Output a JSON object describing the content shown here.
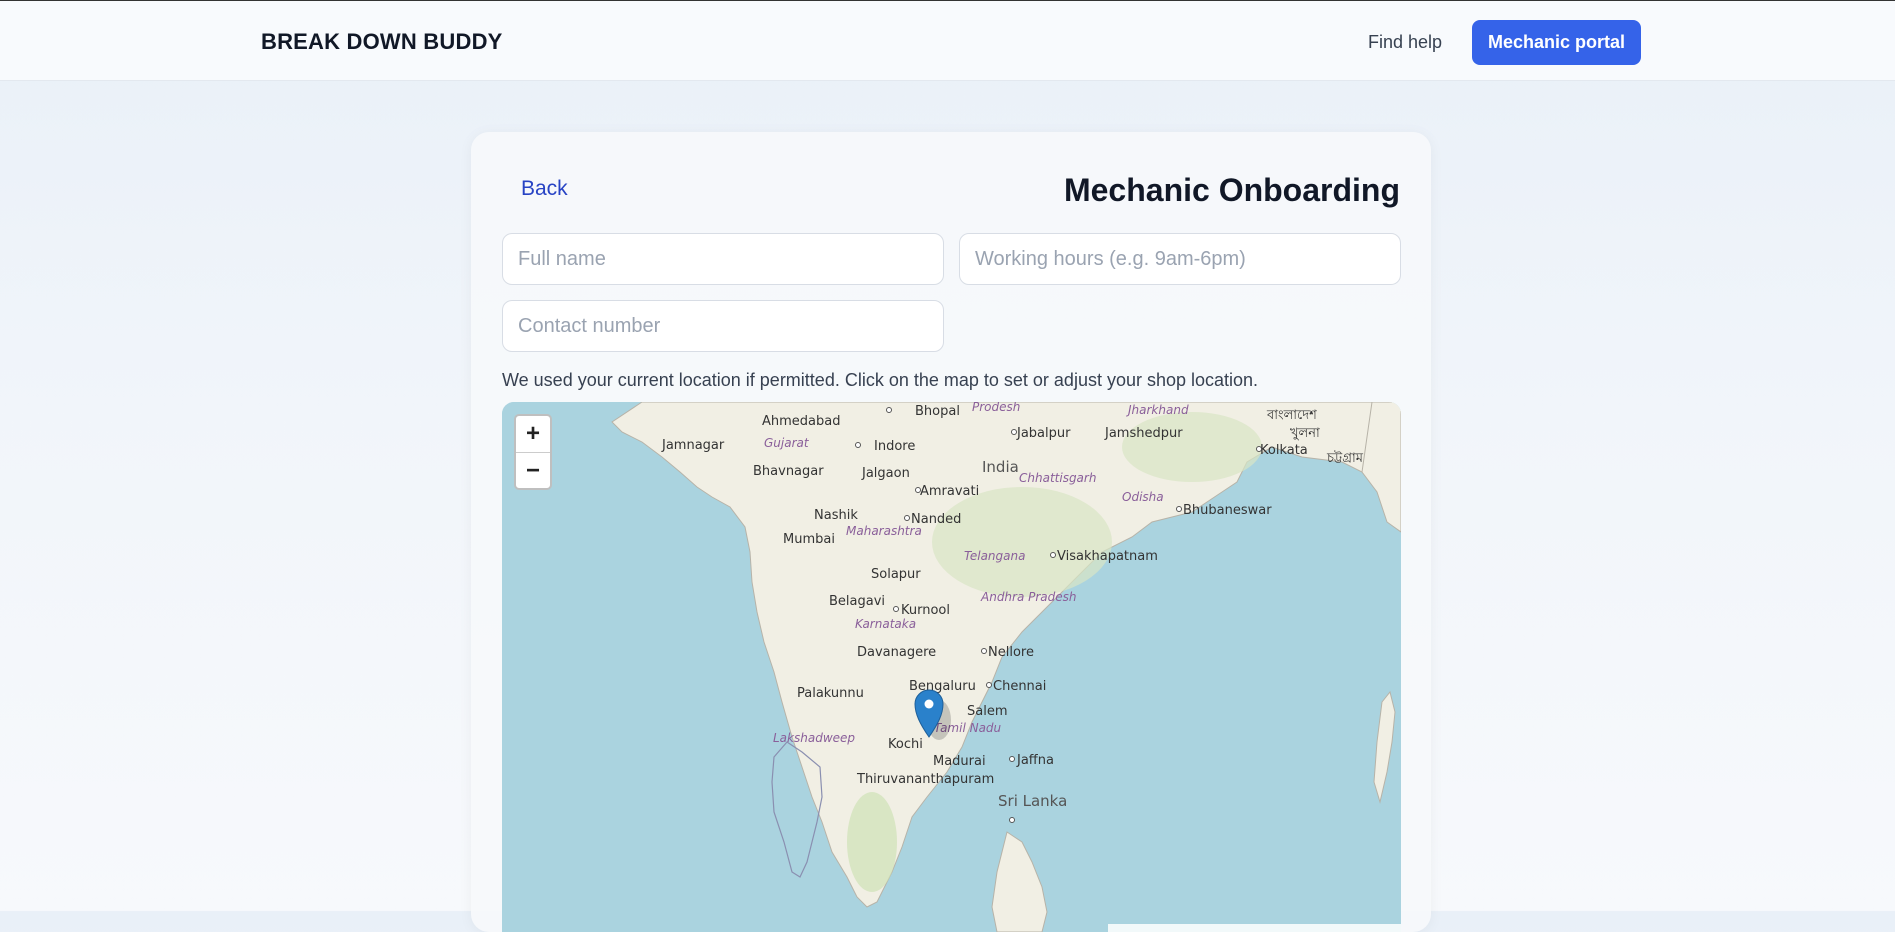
{
  "header": {
    "brand": "BREAK DOWN BUDDY",
    "find_help": "Find help",
    "mechanic_portal": "Mechanic portal"
  },
  "form": {
    "back": "Back",
    "title": "Mechanic Onboarding",
    "full_name_placeholder": "Full name",
    "working_hours_placeholder": "Working hours (e.g. 9am-6pm)",
    "contact_placeholder": "Contact number",
    "location_hint": "We used your current location if permitted. Click on the map to set or adjust your shop location."
  },
  "map": {
    "zoom_in": "+",
    "zoom_out": "−",
    "marker_icon": "map-pin-icon",
    "country": "India",
    "cities": [
      "Ahmedabad",
      "Bhopal",
      "Jabalpur",
      "Jamshedpur",
      "Kolkata",
      "Jamnagar",
      "Indore",
      "Bhavnagar",
      "Jalgaon",
      "Amravati",
      "Nashik",
      "Nanded",
      "Bhubaneswar",
      "Mumbai",
      "Visakhapatnam",
      "Solapur",
      "Belagavi",
      "Kurnool",
      "Davanagere",
      "Nellore",
      "Bengaluru",
      "Chennai",
      "Palakunnu",
      "Salem",
      "Kochi",
      "Madurai",
      "Jaffna",
      "Thiruvananthapuram",
      "Sri Lanka",
      "খুলনা",
      "চট্টগ্রাম",
      "বাংলাদেশ"
    ],
    "states": [
      "Prodesh",
      "Jharkhand",
      "Gujarat",
      "Chhattisgarh",
      "Odisha",
      "Maharashtra",
      "Telangana",
      "Andhra Pradesh",
      "Karnataka",
      "Tamil Nadu",
      "Lakshadweep"
    ],
    "colors": {
      "water": "#aad3df",
      "land": "#f1efe4",
      "marker": "#2a81cb"
    }
  }
}
